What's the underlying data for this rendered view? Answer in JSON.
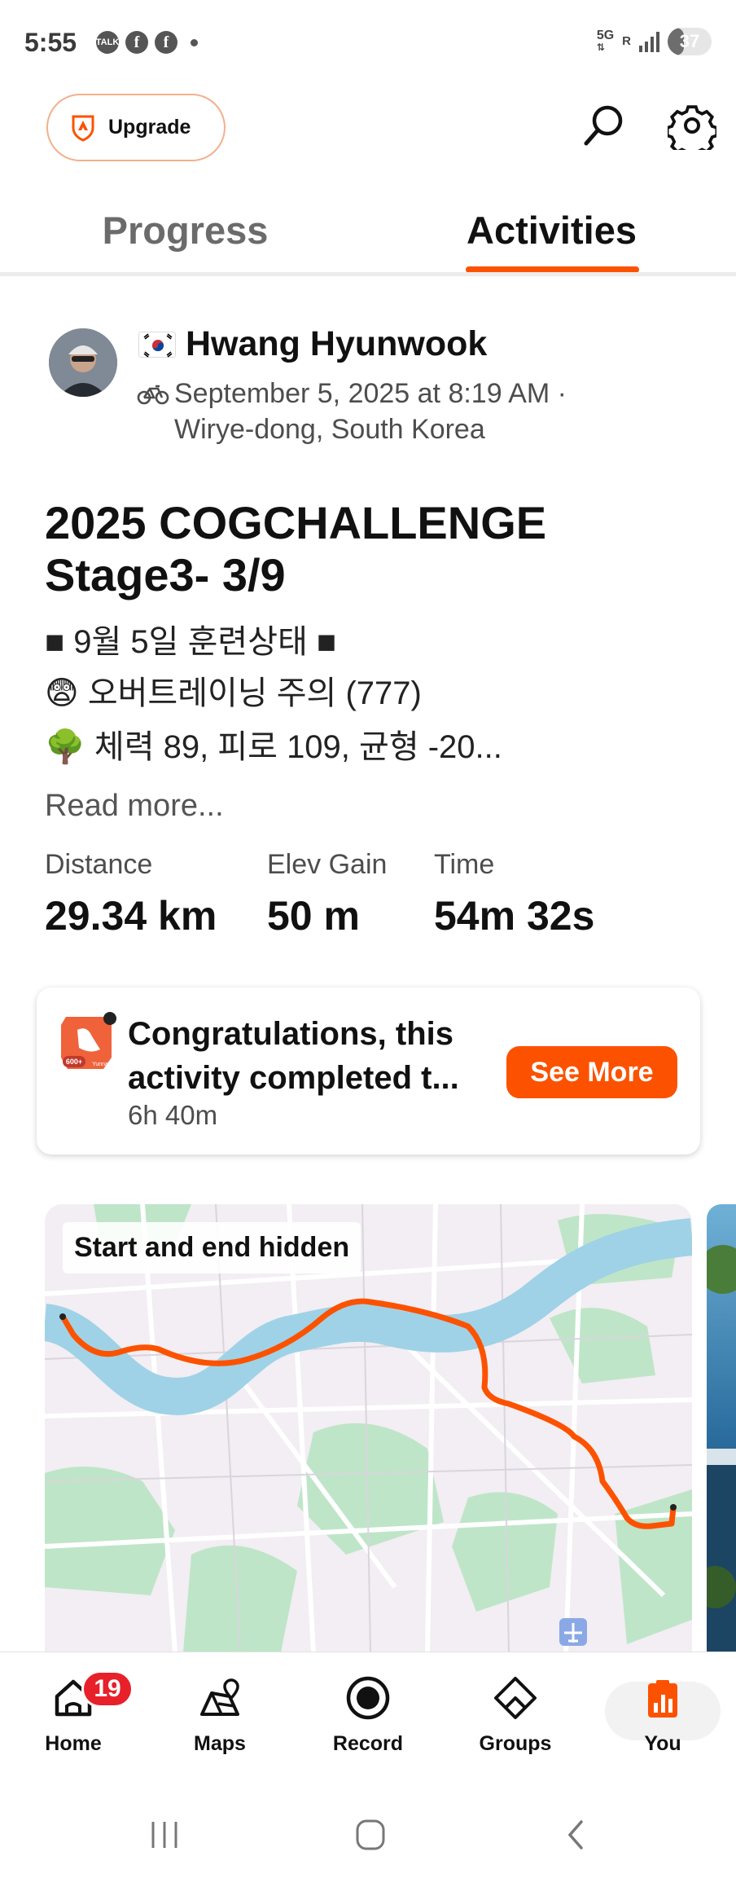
{
  "status_bar": {
    "time": "5:55",
    "notif_icons": [
      "talk-icon",
      "facebook-icon",
      "facebook-icon",
      "dot-icon"
    ],
    "talk_text": "TALK",
    "network": "5G",
    "signal": "R",
    "battery": "37",
    "battery_level": 0.37
  },
  "top_bar": {
    "upgrade_label": "Upgrade",
    "icons": [
      "search-icon",
      "gear-icon"
    ]
  },
  "tabs": [
    {
      "label": "Progress",
      "active": false
    },
    {
      "label": "Activities",
      "active": true
    }
  ],
  "activity": {
    "athlete_name": "Hwang Hyunwook",
    "flag": "south-korea-flag",
    "activity_type": "bike-icon",
    "date": "September 5, 2025 at 8:19 AM ·",
    "location": "Wirye-dong, South Korea",
    "title_line1": "2025 COGCHALLENGE",
    "title_line2": "Stage3- 3/9",
    "description": [
      "■ 9월 5일 훈련상태 ■",
      "😨 오버트레이닝 주의 (777)",
      "🌳 체력 89, 피로 109, 균형 -20..."
    ],
    "read_more": "Read more...",
    "stats": [
      {
        "label": "Distance",
        "value": "29.34 km"
      },
      {
        "label": "Elev Gain",
        "value": "50 m"
      },
      {
        "label": "Time",
        "value": "54m 32s"
      }
    ]
  },
  "congrats_card": {
    "title": "Congratulations, this activity completed t...",
    "time_ago": "6h 40m",
    "button": "See More",
    "badge_text": "600+",
    "badge_sub": "Yunna"
  },
  "map": {
    "label": "Start and end hidden",
    "route_color": "#fc5200"
  },
  "bottom_nav": {
    "items": [
      {
        "label": "Home",
        "icon": "home-icon",
        "badge": "19"
      },
      {
        "label": "Maps",
        "icon": "maps-icon"
      },
      {
        "label": "Record",
        "icon": "record-icon"
      },
      {
        "label": "Groups",
        "icon": "groups-icon"
      },
      {
        "label": "You",
        "icon": "you-icon",
        "active": true
      }
    ]
  },
  "colors": {
    "accent": "#fc5200",
    "badge_red": "#e8202a"
  }
}
